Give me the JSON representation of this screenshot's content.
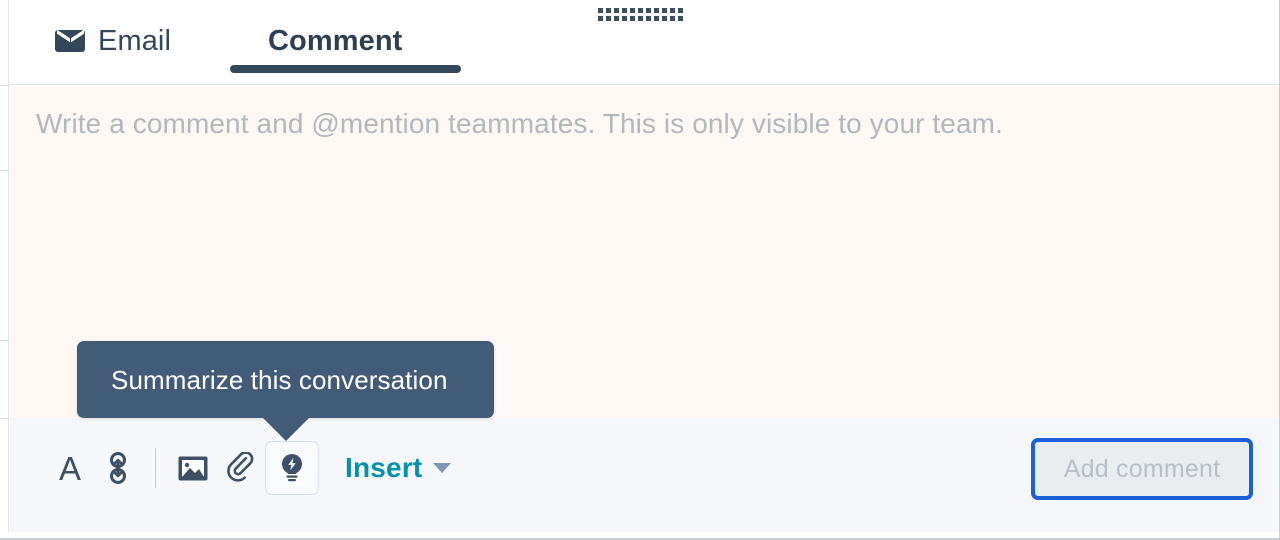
{
  "window": {
    "drag_handle_icon": "drag-grip-icon"
  },
  "tabs": [
    {
      "id": "email",
      "label": "Email",
      "icon": "envelope-icon",
      "active": false
    },
    {
      "id": "comment",
      "label": "Comment",
      "icon": "",
      "active": true
    }
  ],
  "compose": {
    "placeholder": "Write a comment and @mention teammates. This is only visible to your team.",
    "value": ""
  },
  "tooltip": {
    "text": "Summarize this conversation",
    "target": "summarize-button"
  },
  "toolbar": {
    "buttons": [
      {
        "id": "text-format",
        "icon": "text-format-icon",
        "glyph": "A"
      },
      {
        "id": "insert-link",
        "icon": "link-icon",
        "glyph": ""
      },
      {
        "id": "insert-image",
        "icon": "image-icon",
        "glyph": ""
      },
      {
        "id": "attach-file",
        "icon": "paperclip-icon",
        "glyph": ""
      },
      {
        "id": "summarize",
        "icon": "lightbulb-bolt-icon",
        "glyph": ""
      }
    ],
    "insert_label": "Insert",
    "insert_caret_icon": "chevron-down-icon",
    "submit_label": "Add comment",
    "submit_disabled": true
  },
  "colors": {
    "tab_active_underline": "#33475b",
    "tab_text": "#33475b",
    "compose_background": "#fdf8f3",
    "toolbar_background": "#f5f7fa",
    "placeholder_text": "#b3b8bd",
    "insert_accent": "#0091ae",
    "tooltip_background": "#425b76",
    "focus_ring": "#1b5fd9",
    "icon": "#3d5066"
  }
}
